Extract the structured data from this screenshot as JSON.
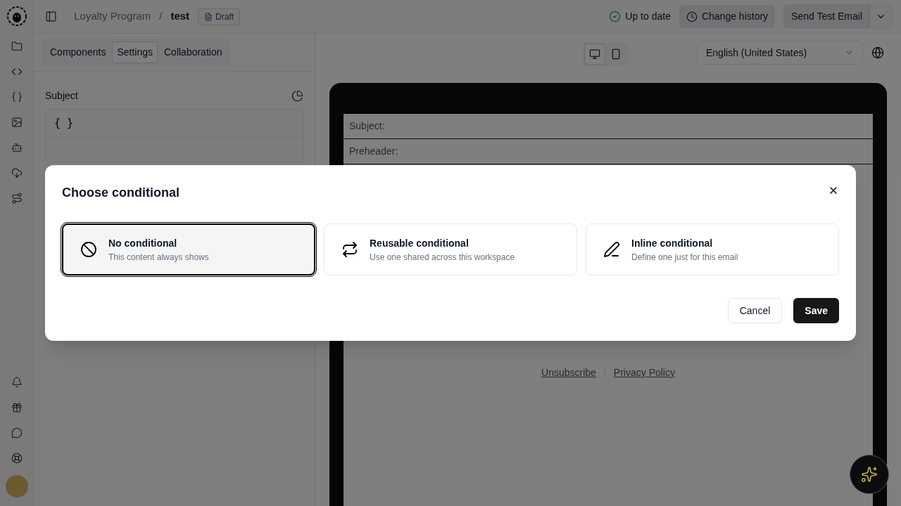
{
  "breadcrumb": {
    "parent": "Loyalty Program",
    "separator": "/",
    "current": "test",
    "badge": "Draft"
  },
  "status": "Up to date",
  "history_button": "Change history",
  "send_button": "Send Test Email",
  "panel_tabs": [
    {
      "label": "Components",
      "selected": false
    },
    {
      "label": "Settings",
      "selected": true
    },
    {
      "label": "Collaboration",
      "selected": false
    }
  ],
  "subject_field": {
    "label": "Subject",
    "value": "{ }"
  },
  "device_toggle": [
    {
      "kind": "desktop",
      "selected": true
    },
    {
      "kind": "mobile",
      "selected": false
    }
  ],
  "language_select": {
    "value": "English (United States)"
  },
  "email_preview": {
    "subject_label": "Subject:",
    "preheader_label": "Preheader:",
    "links": [
      "Unsubscribe",
      "Privacy Policy"
    ]
  },
  "dialog": {
    "title": "Choose conditional",
    "options": [
      {
        "kind": "none",
        "title": "No conditional",
        "description": "This content always shows",
        "selected": true
      },
      {
        "kind": "reusable",
        "title": "Reusable conditional",
        "description": "Use one shared across this workspace",
        "selected": false
      },
      {
        "kind": "inline",
        "title": "Inline conditional",
        "description": "Define one just for this email",
        "selected": false
      }
    ],
    "buttons": [
      {
        "kind": "secondary",
        "label": "Cancel"
      },
      {
        "kind": "primary",
        "label": "Save"
      }
    ]
  }
}
